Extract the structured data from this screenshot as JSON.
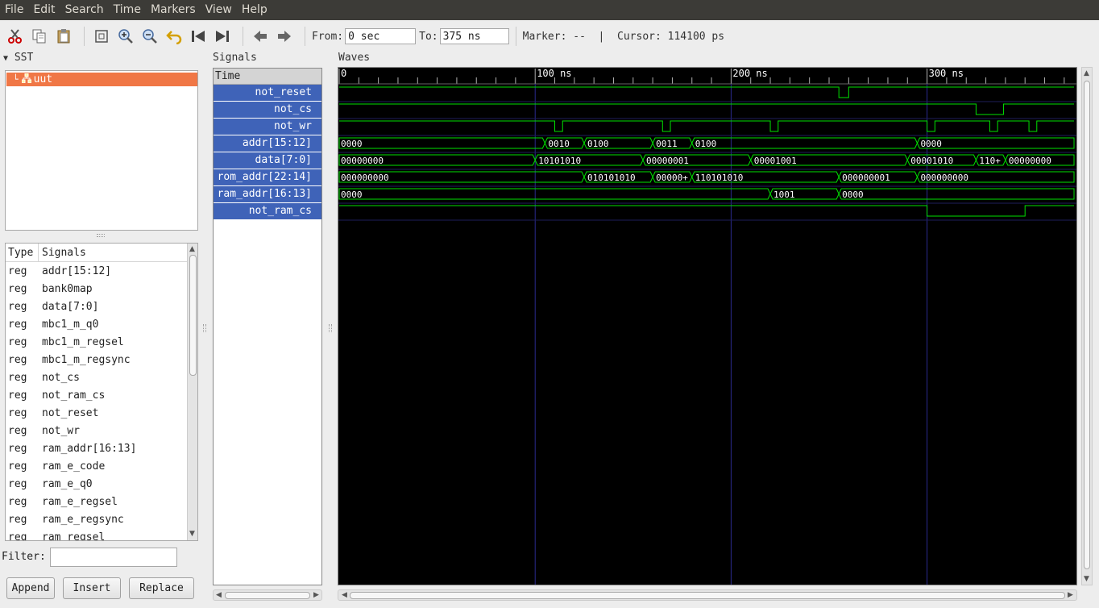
{
  "menu": [
    "File",
    "Edit",
    "Search",
    "Time",
    "Markers",
    "View",
    "Help"
  ],
  "toolbar": {
    "from_label": "From:",
    "from_value": "0 sec",
    "to_label": "To:",
    "to_value": "375 ns",
    "marker_text": "Marker: --  |  Cursor: 114100 ps",
    "icons": [
      "cut-icon",
      "copy-icon",
      "paste-icon",
      "zoom-fit-icon",
      "zoom-in-icon",
      "zoom-out-icon",
      "undo-icon",
      "goto-start-icon",
      "goto-end-icon",
      "back-icon",
      "forward-icon"
    ]
  },
  "sst": {
    "title": "SST",
    "tree_item": "uut"
  },
  "signal_list": {
    "col_type": "Type",
    "col_signals": "Signals",
    "rows": [
      {
        "type": "reg",
        "name": "addr[15:12]"
      },
      {
        "type": "reg",
        "name": "bank0map"
      },
      {
        "type": "reg",
        "name": "data[7:0]"
      },
      {
        "type": "reg",
        "name": "mbc1_m_q0"
      },
      {
        "type": "reg",
        "name": "mbc1_m_regsel"
      },
      {
        "type": "reg",
        "name": "mbc1_m_regsync"
      },
      {
        "type": "reg",
        "name": "not_cs"
      },
      {
        "type": "reg",
        "name": "not_ram_cs"
      },
      {
        "type": "reg",
        "name": "not_reset"
      },
      {
        "type": "reg",
        "name": "not_wr"
      },
      {
        "type": "reg",
        "name": "ram_addr[16:13]"
      },
      {
        "type": "reg",
        "name": "ram_e_code"
      },
      {
        "type": "reg",
        "name": "ram_e_q0"
      },
      {
        "type": "reg",
        "name": "ram_e_regsel"
      },
      {
        "type": "reg",
        "name": "ram_e_regsync"
      },
      {
        "type": "reg",
        "name": "ram_regsel"
      }
    ]
  },
  "filter": {
    "label": "Filter:",
    "value": ""
  },
  "buttons": {
    "append": "Append",
    "insert": "Insert",
    "replace": "Replace"
  },
  "signals_pane": {
    "title": "Signals",
    "time_label": "Time",
    "names": [
      "not_reset",
      "not_cs",
      "not_wr",
      "addr[15:12]",
      "data[7:0]",
      "rom_addr[22:14]",
      "ram_addr[16:13]",
      "not_ram_cs"
    ]
  },
  "waves_pane": {
    "title": "Waves",
    "range_ns": [
      0,
      375
    ],
    "ticks": [
      {
        "t": 0,
        "label": "0"
      },
      {
        "t": 100,
        "label": "100 ns"
      },
      {
        "t": 200,
        "label": "200 ns"
      },
      {
        "t": 300,
        "label": "300 ns"
      }
    ],
    "colors": {
      "wave": "#00e000",
      "grid": "#2b2b8f",
      "text": "#ffffff",
      "bg": "#000000"
    },
    "traces": [
      {
        "name": "not_reset",
        "kind": "bit",
        "edges": [
          [
            0,
            1
          ],
          [
            255,
            0
          ],
          [
            260,
            1
          ]
        ]
      },
      {
        "name": "not_cs",
        "kind": "bit",
        "edges": [
          [
            0,
            1
          ],
          [
            325,
            0
          ],
          [
            339,
            1
          ]
        ]
      },
      {
        "name": "not_wr",
        "kind": "bit",
        "edges": [
          [
            0,
            1
          ],
          [
            110,
            0
          ],
          [
            114,
            1
          ],
          [
            165,
            0
          ],
          [
            169,
            1
          ],
          [
            220,
            0
          ],
          [
            224,
            1
          ],
          [
            300,
            0
          ],
          [
            304,
            1
          ],
          [
            332,
            0
          ],
          [
            336,
            1
          ],
          [
            352,
            0
          ],
          [
            356,
            1
          ]
        ]
      },
      {
        "name": "addr[15:12]",
        "kind": "bus",
        "segments": [
          [
            0,
            "0000"
          ],
          [
            105,
            "0010"
          ],
          [
            125,
            "0100"
          ],
          [
            160,
            "0011"
          ],
          [
            180,
            "0100"
          ],
          [
            295,
            "0000"
          ]
        ]
      },
      {
        "name": "data[7:0]",
        "kind": "bus",
        "segments": [
          [
            0,
            "00000000"
          ],
          [
            100,
            "10101010"
          ],
          [
            155,
            "00000001"
          ],
          [
            210,
            "00001001"
          ],
          [
            290,
            "00001010"
          ],
          [
            325,
            "110+"
          ],
          [
            340,
            "00000000"
          ]
        ]
      },
      {
        "name": "rom_addr[22:14]",
        "kind": "bus",
        "segments": [
          [
            0,
            "000000000"
          ],
          [
            125,
            "010101010"
          ],
          [
            160,
            "00000+"
          ],
          [
            180,
            "110101010"
          ],
          [
            255,
            "000000001"
          ],
          [
            295,
            "000000000"
          ]
        ]
      },
      {
        "name": "ram_addr[16:13]",
        "kind": "bus",
        "segments": [
          [
            0,
            "0000"
          ],
          [
            220,
            "1001"
          ],
          [
            255,
            "0000"
          ]
        ]
      },
      {
        "name": "not_ram_cs",
        "kind": "bit",
        "edges": [
          [
            0,
            1
          ],
          [
            300,
            0
          ],
          [
            350,
            1
          ]
        ]
      }
    ]
  },
  "accent": {
    "selection": "#f07746",
    "signal_bg": "#3f63b8",
    "menubar_bg": "#3c3b37"
  }
}
